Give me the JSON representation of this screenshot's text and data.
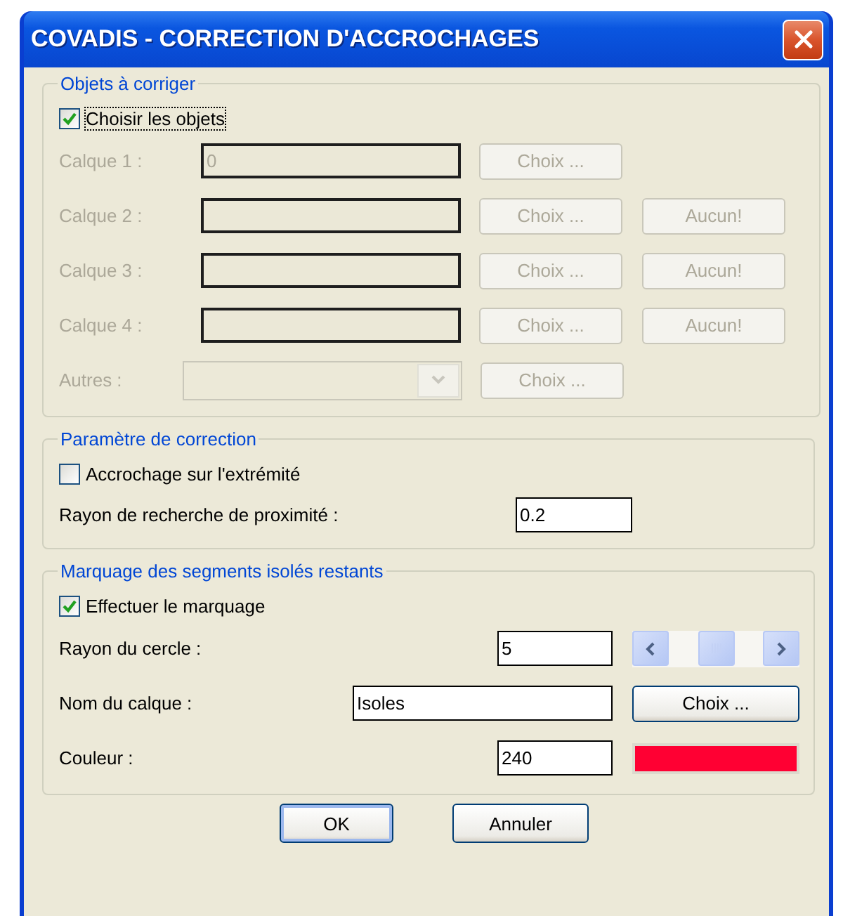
{
  "window": {
    "title": "COVADIS - CORRECTION D'ACCROCHAGES"
  },
  "objects_group": {
    "title": "Objets à corriger",
    "checkbox": {
      "label": "Choisir les objets",
      "checked": true
    },
    "rows": [
      {
        "kind": "layer",
        "label": "Calque 1 :",
        "value": "0",
        "disabled": true,
        "buttons": [
          "Choix ..."
        ]
      },
      {
        "kind": "layer",
        "label": "Calque 2 :",
        "disabled": true,
        "buttons": [
          "Choix ...",
          "Aucun!"
        ]
      },
      {
        "kind": "layer",
        "label": "Calque 3 :",
        "disabled": true,
        "buttons": [
          "Choix ...",
          "Aucun!"
        ]
      },
      {
        "kind": "layer",
        "label": "Calque 4 :",
        "disabled": true,
        "buttons": [
          "Choix ...",
          "Aucun!"
        ]
      },
      {
        "kind": "dropdown",
        "label": "Autres :",
        "disabled": true,
        "buttons": [
          "Choix ..."
        ]
      }
    ]
  },
  "correction_group": {
    "title": "Paramètre de correction",
    "checkbox": {
      "label": "Accrochage sur l'extrémité",
      "checked": false
    },
    "field": {
      "label": "Rayon de recherche de proximité :",
      "value": "0.2"
    }
  },
  "marking_group": {
    "title": "Marquage des segments isolés restants",
    "checkbox": {
      "label": "Effectuer le marquage",
      "checked": true
    },
    "rows": [
      {
        "kind": "spinner",
        "label": "Rayon du cercle :",
        "value": "5"
      },
      {
        "kind": "choose",
        "label": "Nom du calque :",
        "value": "Isoles",
        "button": "Choix ..."
      },
      {
        "kind": "color",
        "label": "Couleur :",
        "value": "240",
        "color": "#ff0033"
      }
    ]
  },
  "buttons": [
    "OK",
    "Annuler"
  ]
}
